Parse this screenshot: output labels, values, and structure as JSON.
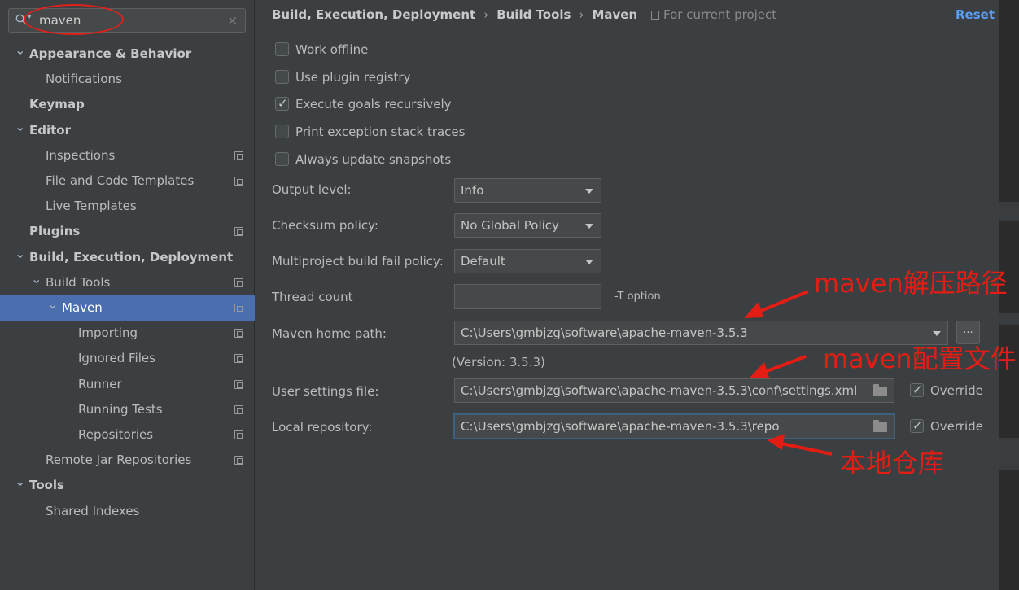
{
  "search": {
    "query": "maven",
    "clear_icon": "×"
  },
  "sidebar": {
    "items": [
      {
        "label": "Appearance & Behavior",
        "bold": true,
        "indent": 0,
        "arrow": "v",
        "icon": false
      },
      {
        "label": "Notifications",
        "bold": false,
        "indent": 1,
        "arrow": "",
        "icon": false
      },
      {
        "label": "Keymap",
        "bold": true,
        "indent": 0,
        "arrow": "",
        "icon": false
      },
      {
        "label": "Editor",
        "bold": true,
        "indent": 0,
        "arrow": "v",
        "icon": false
      },
      {
        "label": "Inspections",
        "bold": false,
        "indent": 1,
        "arrow": "",
        "icon": true
      },
      {
        "label": "File and Code Templates",
        "bold": false,
        "indent": 1,
        "arrow": "",
        "icon": true
      },
      {
        "label": "Live Templates",
        "bold": false,
        "indent": 1,
        "arrow": "",
        "icon": false
      },
      {
        "label": "Plugins",
        "bold": true,
        "indent": 0,
        "arrow": "",
        "icon": true
      },
      {
        "label": "Build, Execution, Deployment",
        "bold": true,
        "indent": 0,
        "arrow": "v",
        "icon": false
      },
      {
        "label": "Build Tools",
        "bold": false,
        "indent": 1,
        "arrow": "v",
        "icon": true
      },
      {
        "label": "Maven",
        "bold": false,
        "indent": 2,
        "arrow": "v",
        "icon": true,
        "selected": true
      },
      {
        "label": "Importing",
        "bold": false,
        "indent": 3,
        "arrow": "",
        "icon": true
      },
      {
        "label": "Ignored Files",
        "bold": false,
        "indent": 3,
        "arrow": "",
        "icon": true
      },
      {
        "label": "Runner",
        "bold": false,
        "indent": 3,
        "arrow": "",
        "icon": true
      },
      {
        "label": "Running Tests",
        "bold": false,
        "indent": 3,
        "arrow": "",
        "icon": true
      },
      {
        "label": "Repositories",
        "bold": false,
        "indent": 3,
        "arrow": "",
        "icon": true
      },
      {
        "label": "Remote Jar Repositories",
        "bold": false,
        "indent": 1,
        "arrow": "",
        "icon": true
      },
      {
        "label": "Tools",
        "bold": true,
        "indent": 0,
        "arrow": "v",
        "icon": false
      },
      {
        "label": "Shared Indexes",
        "bold": false,
        "indent": 1,
        "arrow": "",
        "icon": false
      }
    ]
  },
  "header": {
    "breadcrumb": [
      "Build, Execution, Deployment",
      "Build Tools",
      "Maven"
    ],
    "separator": "›",
    "for_project": "For current project",
    "reset": "Reset"
  },
  "options": {
    "checkboxes": [
      {
        "label": "Work offline",
        "checked": false
      },
      {
        "label": "Use plugin registry",
        "checked": false
      },
      {
        "label": "Execute goals recursively",
        "checked": true
      },
      {
        "label": "Print exception stack traces",
        "checked": false
      },
      {
        "label": "Always update snapshots",
        "checked": false
      }
    ],
    "output_level": {
      "label": "Output level:",
      "value": "Info"
    },
    "checksum_policy": {
      "label": "Checksum policy:",
      "value": "No Global Policy"
    },
    "fail_policy": {
      "label": "Multiproject build fail policy:",
      "value": "Default"
    },
    "thread_count": {
      "label": "Thread count",
      "value": "",
      "hint": "-T option"
    },
    "maven_home": {
      "label": "Maven home path:",
      "value": "C:\\Users\\gmbjzg\\software\\apache-maven-3.5.3",
      "version": "(Version: 3.5.3)",
      "browse": "..."
    },
    "user_settings": {
      "label": "User settings file:",
      "value": "C:\\Users\\gmbjzg\\software\\apache-maven-3.5.3\\conf\\settings.xml",
      "override_label": "Override",
      "override": true
    },
    "local_repo": {
      "label": "Local repository:",
      "value": "C:\\Users\\gmbjzg\\software\\apache-maven-3.5.3\\repo",
      "override_label": "Override",
      "override": true
    }
  },
  "annotations": {
    "maven_home_note": "maven解压路径",
    "settings_note": "maven配置文件",
    "repo_note": "本地仓库"
  },
  "colors": {
    "background": "#3c3f41",
    "selection": "#4b6eaf",
    "link": "#589df6",
    "annotation": "#e41d14"
  }
}
